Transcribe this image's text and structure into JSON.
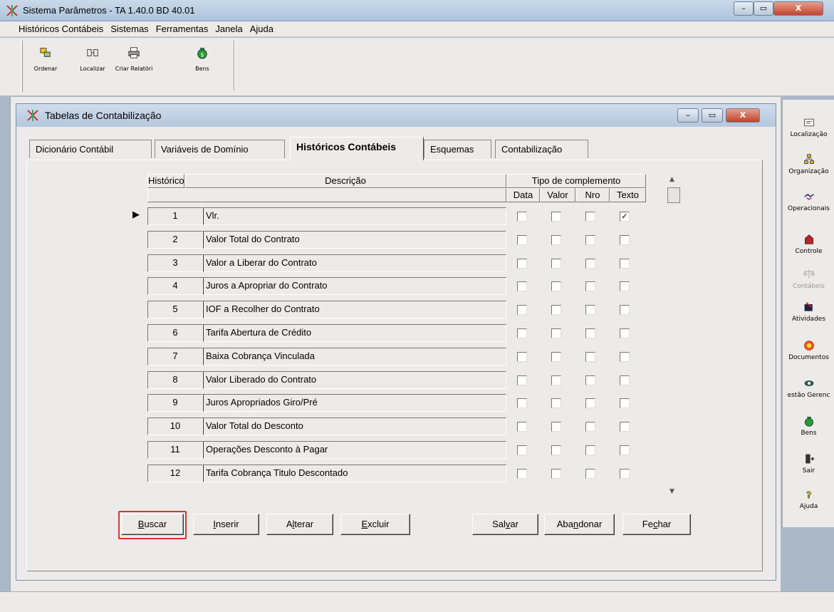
{
  "window": {
    "title": "Sistema Parâmetros -  TA 1.40.0 BD 40.01"
  },
  "menu": [
    "Históricos Contábeis",
    "Sistemas",
    "Ferramentas",
    "Janela",
    "Ajuda"
  ],
  "toolbar": [
    "Ordenar",
    "Localizar",
    "Criar Relatóri",
    "Bens"
  ],
  "sidebar": [
    "Localização",
    "Organização",
    "Operacionais",
    "Controle",
    "Contábeis",
    "Atividades",
    "Documentos",
    "estão Gerenc",
    "Bens",
    "Sair",
    "Ajuda"
  ],
  "inner_window": {
    "title": "Tabelas de Contabilização"
  },
  "tabs": [
    "Dicionário Contábil",
    "Variáveis de Domínio",
    "Históricos Contábeis",
    "Esquemas",
    "Contabilização"
  ],
  "active_tab": "Históricos Contábeis",
  "grid": {
    "headers": {
      "historico": "Histórico",
      "descricao": "Descrição",
      "tipo": "Tipo de complemento",
      "data": "Data",
      "valor": "Valor",
      "nro": "Nro",
      "texto": "Texto"
    },
    "rows": [
      {
        "id": "1",
        "desc": "Vlr.",
        "data": false,
        "valor": false,
        "nro": false,
        "texto": true
      },
      {
        "id": "2",
        "desc": "Valor Total do Contrato",
        "data": false,
        "valor": false,
        "nro": false,
        "texto": false
      },
      {
        "id": "3",
        "desc": "Valor a Liberar do Contrato",
        "data": false,
        "valor": false,
        "nro": false,
        "texto": false
      },
      {
        "id": "4",
        "desc": "Juros a Apropriar do Contrato",
        "data": false,
        "valor": false,
        "nro": false,
        "texto": false
      },
      {
        "id": "5",
        "desc": "IOF a Recolher do Contrato",
        "data": false,
        "valor": false,
        "nro": false,
        "texto": false
      },
      {
        "id": "6",
        "desc": "Tarifa Abertura de Crédito",
        "data": false,
        "valor": false,
        "nro": false,
        "texto": false
      },
      {
        "id": "7",
        "desc": "Baixa Cobrança Vinculada",
        "data": false,
        "valor": false,
        "nro": false,
        "texto": false
      },
      {
        "id": "8",
        "desc": "Valor Liberado do Contrato",
        "data": false,
        "valor": false,
        "nro": false,
        "texto": false
      },
      {
        "id": "9",
        "desc": "Juros Apropriados Giro/Pré",
        "data": false,
        "valor": false,
        "nro": false,
        "texto": false
      },
      {
        "id": "10",
        "desc": "Valor Total do Desconto",
        "data": false,
        "valor": false,
        "nro": false,
        "texto": false
      },
      {
        "id": "11",
        "desc": "Operações Desconto à Pagar",
        "data": false,
        "valor": false,
        "nro": false,
        "texto": false
      },
      {
        "id": "12",
        "desc": "Tarifa Cobrança Titulo Descontado",
        "data": false,
        "valor": false,
        "nro": false,
        "texto": false
      }
    ]
  },
  "buttons": [
    {
      "pre": "",
      "key": "B",
      "post": "uscar"
    },
    {
      "pre": "",
      "key": "I",
      "post": "nserir"
    },
    {
      "pre": "A",
      "key": "l",
      "post": "terar"
    },
    {
      "pre": "",
      "key": "E",
      "post": "xcluir"
    },
    {
      "pre": "Sal",
      "key": "v",
      "post": "ar"
    },
    {
      "pre": "Aba",
      "key": "n",
      "post": "donar"
    },
    {
      "pre": "Fe",
      "key": "c",
      "post": "har"
    }
  ],
  "highlight_color": "#e0332b"
}
